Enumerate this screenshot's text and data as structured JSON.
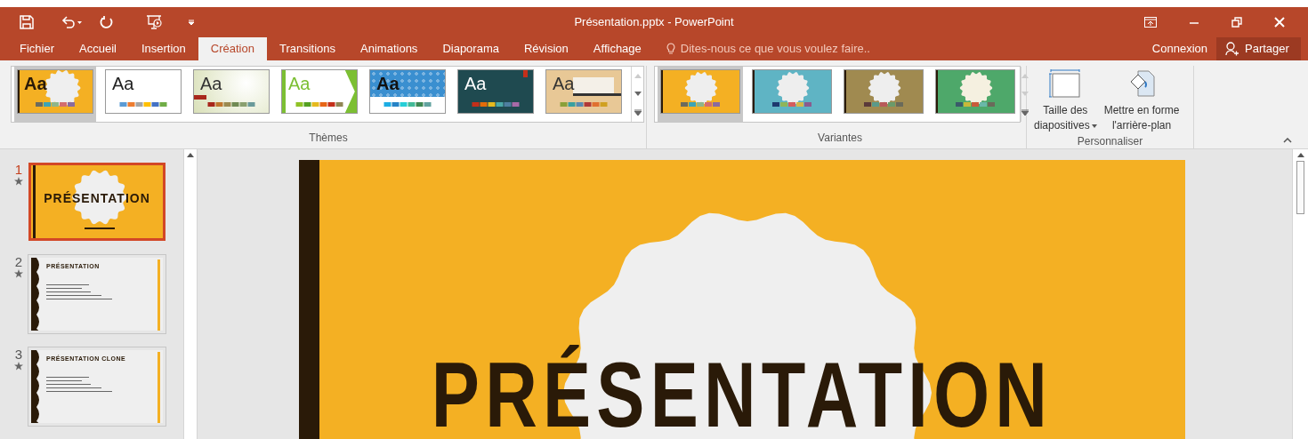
{
  "window": {
    "title": "Présentation.pptx - PowerPoint"
  },
  "tabs": [
    {
      "label": "Fichier",
      "selected": false
    },
    {
      "label": "Accueil",
      "selected": false
    },
    {
      "label": "Insertion",
      "selected": false
    },
    {
      "label": "Création",
      "selected": true
    },
    {
      "label": "Transitions",
      "selected": false
    },
    {
      "label": "Animations",
      "selected": false
    },
    {
      "label": "Diaporama",
      "selected": false
    },
    {
      "label": "Révision",
      "selected": false
    },
    {
      "label": "Affichage",
      "selected": false
    }
  ],
  "tell_me": {
    "placeholder": "Dites-nous ce que vous voulez faire.."
  },
  "signin": "Connexion",
  "share": "Partager",
  "themes": {
    "label": "Thèmes",
    "items": [
      {
        "sample": "Aa",
        "selected": true,
        "kind": "seal"
      },
      {
        "sample": "Aa",
        "selected": false,
        "kind": "plain"
      },
      {
        "sample": "Aa",
        "selected": false,
        "kind": "soft"
      },
      {
        "sample": "Aa",
        "selected": false,
        "kind": "facet"
      },
      {
        "sample": "Aa",
        "selected": false,
        "kind": "pattern"
      },
      {
        "sample": "Aa",
        "selected": false,
        "kind": "dark"
      },
      {
        "sample": "Aa",
        "selected": false,
        "kind": "wood"
      }
    ]
  },
  "variants": {
    "label": "Variantes",
    "items": [
      {
        "selected": true,
        "color": "#f4b023"
      },
      {
        "selected": false,
        "color": "#5fb4c4"
      },
      {
        "selected": false,
        "color": "#a08a50"
      },
      {
        "selected": false,
        "color": "#4ea86a"
      }
    ]
  },
  "customize": {
    "label": "Personnaliser",
    "buttons": [
      {
        "kind": "size",
        "lines": [
          "Taille des",
          "diapositives"
        ],
        "dropdown": true
      },
      {
        "kind": "background",
        "lines": [
          "Mettre en forme",
          "l'arrière-plan"
        ],
        "dropdown": false
      }
    ]
  },
  "slides": [
    {
      "number": "1",
      "title": "PRÉSENTATION",
      "kind": "title",
      "selected": true
    },
    {
      "number": "2",
      "title": "PRÉSENTATION",
      "kind": "content",
      "selected": false
    },
    {
      "number": "3",
      "title": "PRÉSENTATION CLONE",
      "kind": "content",
      "selected": false
    }
  ],
  "main_slide": {
    "title": "PRÉSENTATION"
  }
}
